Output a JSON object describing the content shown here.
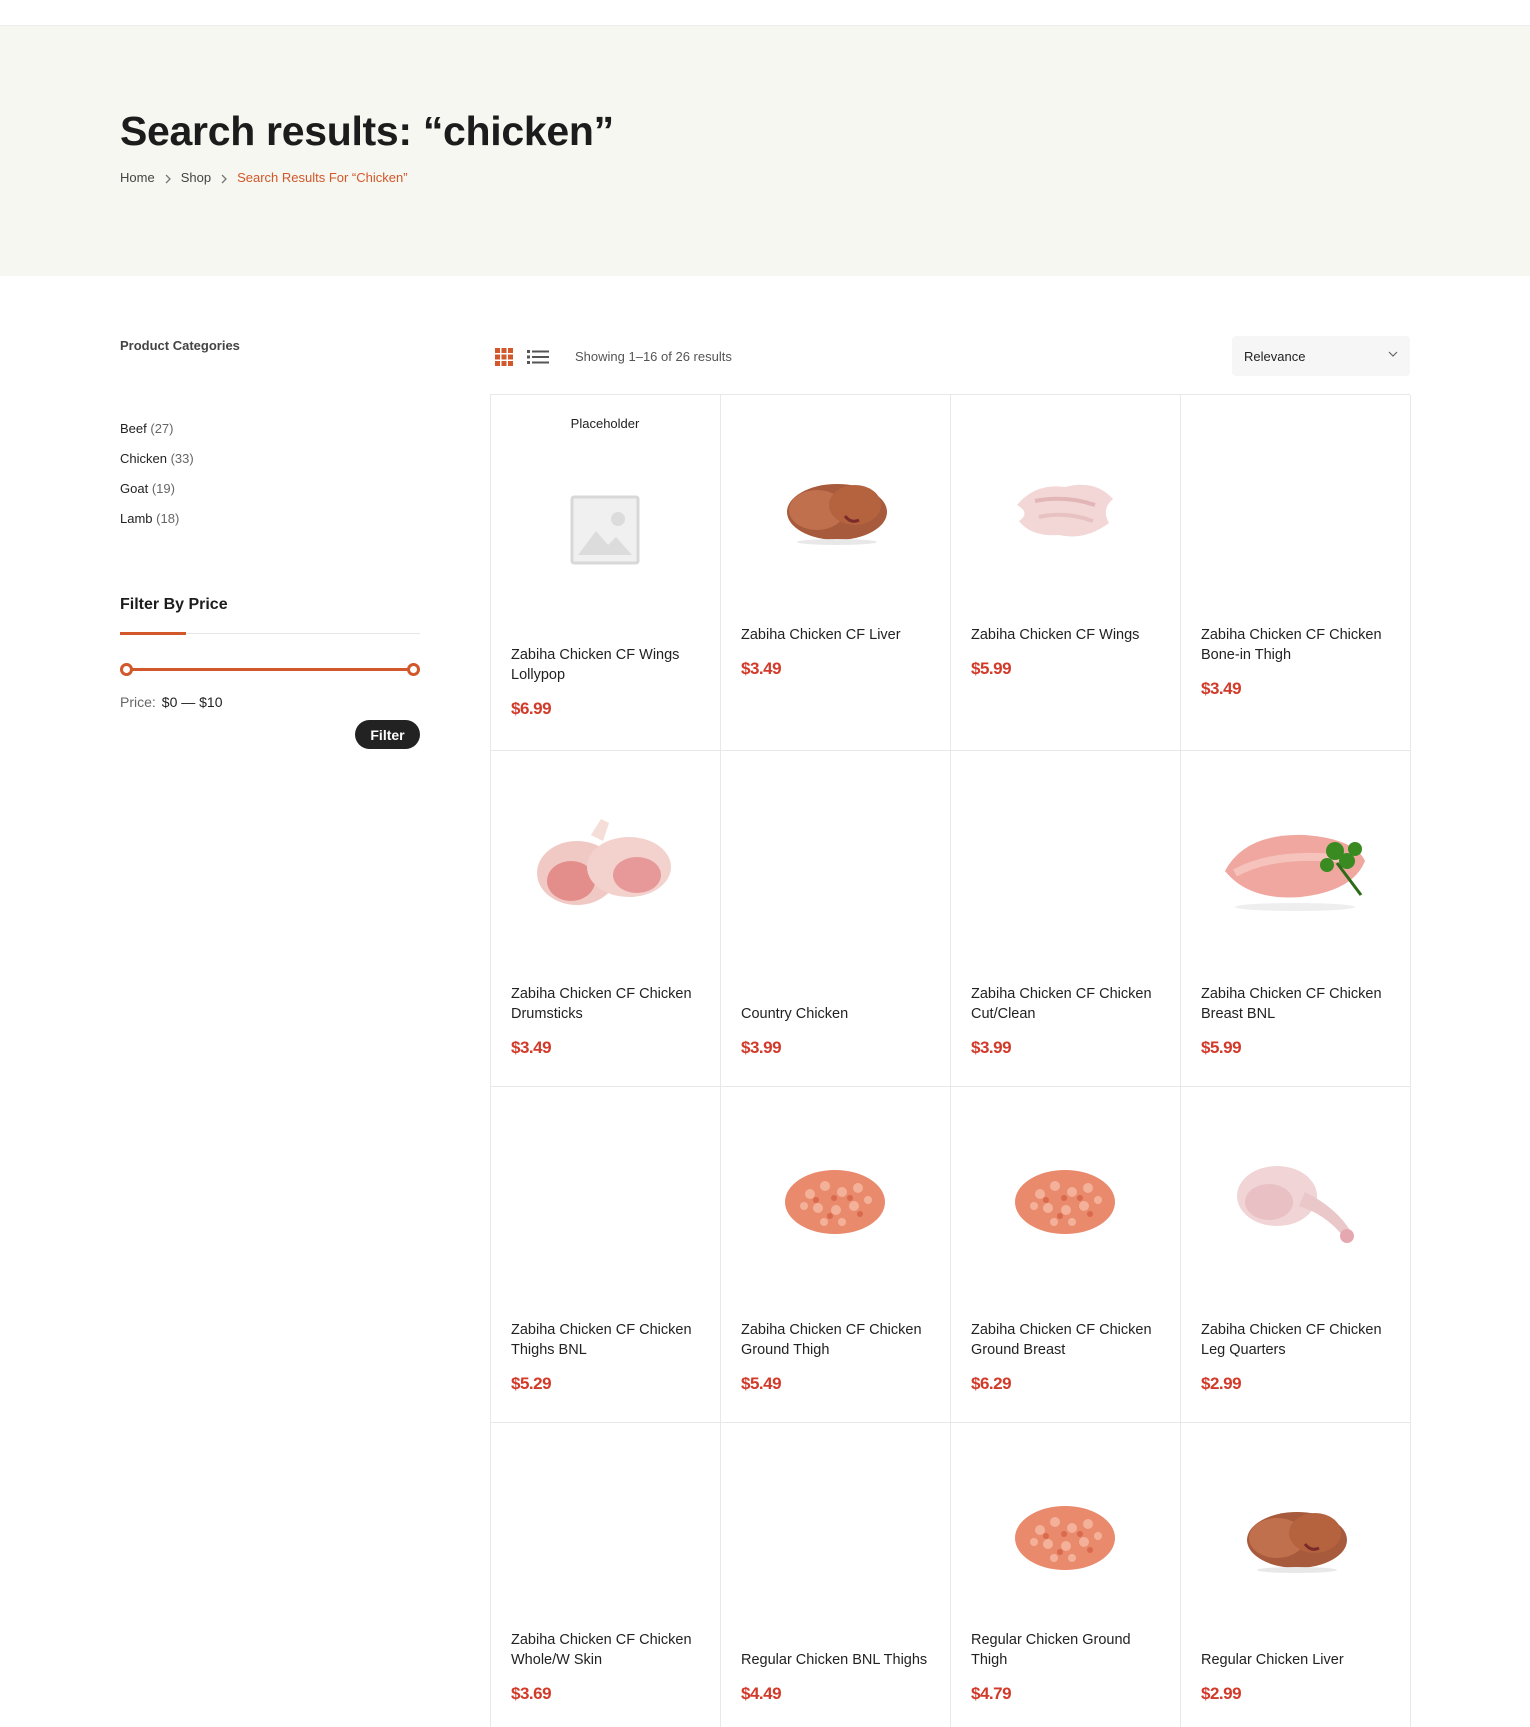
{
  "page": {
    "title": "Search results: “chicken”",
    "breadcrumb": {
      "home": "Home",
      "shop": "Shop",
      "current": "Search Results For “Chicken”"
    }
  },
  "sidebar": {
    "categories_title": "Product Categories",
    "categories": [
      {
        "label": "Beef",
        "count": "(27)"
      },
      {
        "label": "Chicken",
        "count": "(33)"
      },
      {
        "label": "Goat",
        "count": "(19)"
      },
      {
        "label": "Lamb",
        "count": "(18)"
      }
    ],
    "price_filter": {
      "title": "Filter By Price",
      "label": "Price:",
      "range": "$0 — $10",
      "min": 0,
      "max": 10,
      "button": "Filter"
    }
  },
  "toolbar": {
    "result_count": "Showing 1–16 of 26 results",
    "sort_selected": "Relevance",
    "grid_icon": "grid-view-icon",
    "list_icon": "list-view-icon"
  },
  "colors": {
    "accent": "#d2572b",
    "price": "#d23a2a",
    "hero_bg": "#f5f7f0"
  },
  "products": [
    {
      "name": "Zabiha Chicken CF Wings Lollypop",
      "price": "$6.99",
      "image": "placeholder",
      "image_label": "Placeholder"
    },
    {
      "name": "Zabiha Chicken CF Liver",
      "price": "$3.49",
      "image": "liver"
    },
    {
      "name": "Zabiha Chicken CF Wings",
      "price": "$5.99",
      "image": "wings"
    },
    {
      "name": "Zabiha Chicken CF Chicken Bone-in Thigh",
      "price": "$3.49",
      "image": "none"
    },
    {
      "name": "Zabiha Chicken CF Chicken Drumsticks",
      "price": "$3.49",
      "image": "drumsticks"
    },
    {
      "name": "Country Chicken",
      "price": "$3.99",
      "image": "none"
    },
    {
      "name": "Zabiha Chicken CF Chicken Cut/Clean",
      "price": "$3.99",
      "image": "none"
    },
    {
      "name": "Zabiha Chicken CF Chicken Breast BNL",
      "price": "$5.99",
      "image": "breast"
    },
    {
      "name": "Zabiha Chicken CF Chicken Thighs BNL",
      "price": "$5.29",
      "image": "none"
    },
    {
      "name": "Zabiha Chicken CF Chicken Ground Thigh",
      "price": "$5.49",
      "image": "ground"
    },
    {
      "name": "Zabiha Chicken CF Chicken Ground Breast",
      "price": "$6.29",
      "image": "ground"
    },
    {
      "name": "Zabiha Chicken CF Chicken Leg Quarters",
      "price": "$2.99",
      "image": "leg"
    },
    {
      "name": "Zabiha Chicken CF Chicken Whole/W Skin",
      "price": "$3.69",
      "image": "none"
    },
    {
      "name": "Regular Chicken BNL Thighs",
      "price": "$4.49",
      "image": "none"
    },
    {
      "name": "Regular Chicken Ground Thigh",
      "price": "$4.79",
      "image": "ground"
    },
    {
      "name": "Regular Chicken Liver",
      "price": "$2.99",
      "image": "liver"
    }
  ]
}
